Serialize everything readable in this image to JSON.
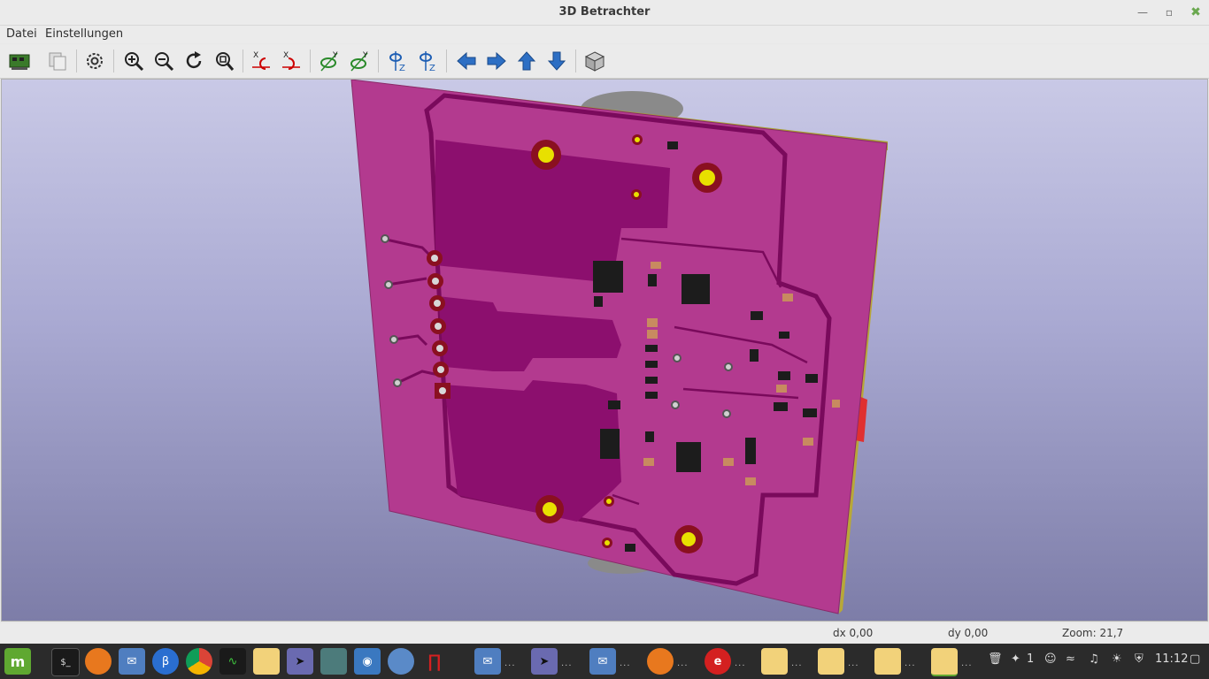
{
  "window": {
    "title": "3D Betrachter"
  },
  "menu": {
    "items": [
      "Datei",
      "Einstellungen"
    ]
  },
  "toolbar": {
    "items": [
      {
        "name": "reload-board-button",
        "icon": "reload-icon"
      },
      {
        "name": "copy-image-button",
        "icon": "copy-icon"
      },
      {
        "name": "settings-button",
        "icon": "gear-icon"
      },
      {
        "name": "zoom-in-button",
        "icon": "zoom-in-icon"
      },
      {
        "name": "zoom-out-button",
        "icon": "zoom-out-icon"
      },
      {
        "name": "redraw-button",
        "icon": "redraw-icon"
      },
      {
        "name": "zoom-fit-button",
        "icon": "zoom-fit-icon"
      },
      {
        "name": "rotate-x-cw-button",
        "icon": "rotate-x-cw-icon",
        "label": "X"
      },
      {
        "name": "rotate-x-ccw-button",
        "icon": "rotate-x-ccw-icon",
        "label": "X"
      },
      {
        "name": "rotate-y-cw-button",
        "icon": "rotate-y-cw-icon",
        "label": "Y"
      },
      {
        "name": "rotate-y-ccw-button",
        "icon": "rotate-y-ccw-icon",
        "label": "Y"
      },
      {
        "name": "rotate-z-cw-button",
        "icon": "rotate-z-cw-icon",
        "label": "Z"
      },
      {
        "name": "rotate-z-ccw-button",
        "icon": "rotate-z-ccw-icon",
        "label": "Z"
      },
      {
        "name": "pan-left-button",
        "icon": "arrow-left-icon"
      },
      {
        "name": "pan-right-button",
        "icon": "arrow-right-icon"
      },
      {
        "name": "pan-up-button",
        "icon": "arrow-up-icon"
      },
      {
        "name": "pan-down-button",
        "icon": "arrow-down-icon"
      },
      {
        "name": "orthographic-button",
        "icon": "cube-icon"
      }
    ]
  },
  "status": {
    "dx": "dx 0,00",
    "dy": "dy 0,00",
    "zoom": "Zoom: 21,7"
  },
  "colors": {
    "board": "#b33a8f",
    "copper_pour": "#8c0f6e",
    "track": "#7a0a5c",
    "board_edge": "#a8a030",
    "pad_gold": "#e8e000",
    "background_top": "#c9c9e6",
    "background_bottom": "#7d7da8"
  },
  "taskbar": {
    "items": [
      "menu-icon",
      "terminal-icon",
      "firefox-icon",
      "mail-icon",
      "bluetooth-icon",
      "chrome-icon",
      "system-monitor-icon",
      "kicad-pcb-icon",
      "kicad-select-icon",
      "display-icon",
      "screenshot-icon",
      "magnifier-icon",
      "red-app-icon",
      "mail-window",
      "kicad-select-window",
      "mail-window-2",
      "firefox-window",
      "red-app-window",
      "kicad-window-1",
      "kicad-window-2",
      "kicad-window-3",
      "kicad-window-4"
    ],
    "tray": {
      "notifications": "1",
      "clock": "11:12"
    }
  }
}
